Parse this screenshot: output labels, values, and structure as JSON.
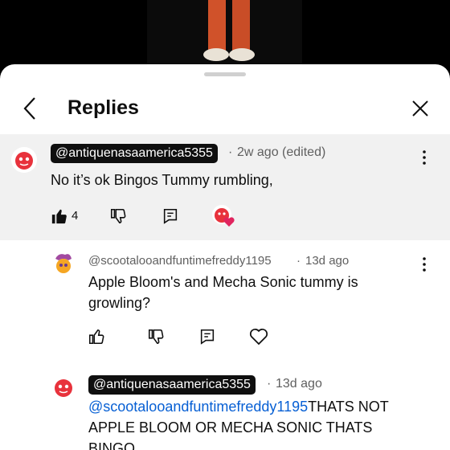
{
  "header": {
    "title": "Replies"
  },
  "comments": [
    {
      "handle": "@antiquenasaamerica5355",
      "separator": "·",
      "time": "2w ago (edited)",
      "text": "No it’s ok Bingos Tummy rumbling,",
      "likes": "4",
      "liked_by_creator": true,
      "highlighted": true
    },
    {
      "handle": "@scootalooandfuntimefreddy1195",
      "separator": "·",
      "time": "13d ago",
      "text_line1": "Apple Bloom's and Mecha Sonic tummy is",
      "text_line2": "growling?"
    },
    {
      "handle": "@antiquenasaamerica5355",
      "separator": "·",
      "time": "13d ago",
      "mention": "@scootalooandfuntimefreddy1195",
      "text_line1_rest": "THATS NOT",
      "text_line2": "APPLE BLOOM OR MECHA SONIC THATS",
      "text_line3": "BINGO"
    }
  ],
  "colors": {
    "link": "#065fd4",
    "chip": "#0f0f0f",
    "highlight_bg": "#f1f1f1",
    "heart": "#e0245e"
  },
  "icons": [
    "back-arrow-icon",
    "close-icon",
    "kebab-menu-icon",
    "thumbs-up-icon",
    "thumbs-down-icon",
    "reply-icon",
    "heart-icon"
  ]
}
